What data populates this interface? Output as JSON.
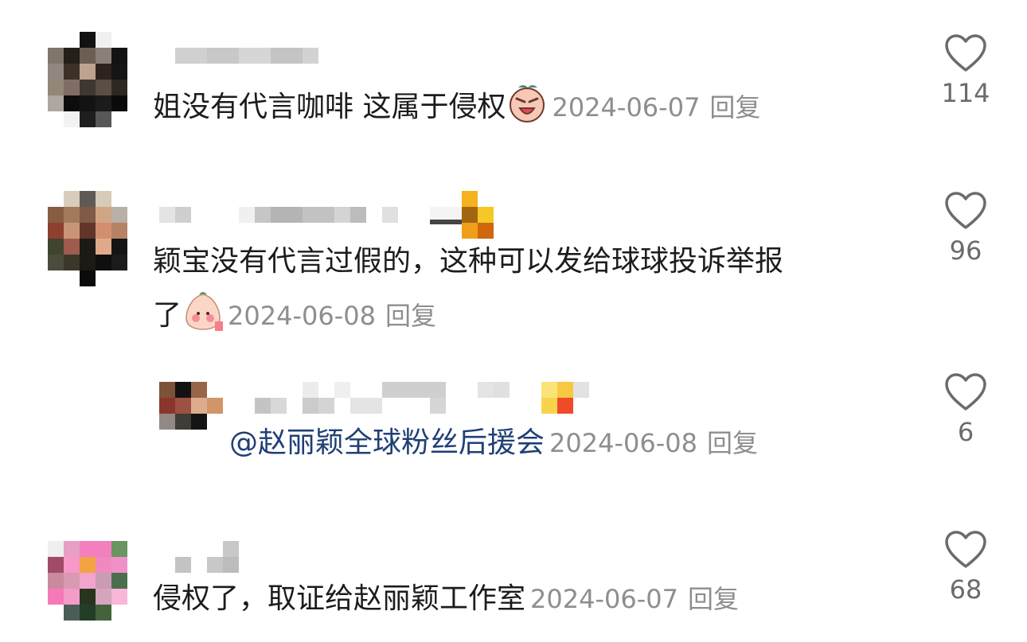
{
  "comments": [
    {
      "text": "姐没有代言咖啡  这属于侵权",
      "emoji": "crying-face-emoji",
      "date": "2024-06-07",
      "reply": "回复",
      "likes": "114"
    },
    {
      "text_line1": "颖宝没有代言过假的，这种可以发给球球投诉举报",
      "text_line2": "了",
      "emoji": "shy-peach-emoji",
      "date": "2024-06-08",
      "reply": "回复",
      "likes": "96"
    },
    {
      "mention": "@赵丽颖全球粉丝后援会",
      "date": "2024-06-08",
      "reply": "回复",
      "likes": "6"
    },
    {
      "text": "侵权了，取证给赵丽颖工作室",
      "date": "2024-06-07",
      "reply": "回复",
      "likes": "68"
    }
  ],
  "colors": {
    "text": "#1c1c1c",
    "meta": "#8e8e8e",
    "mention": "#1f3f75",
    "like_icon": "#6b6b6b"
  },
  "icons": {
    "like": "heart-outline-icon"
  }
}
